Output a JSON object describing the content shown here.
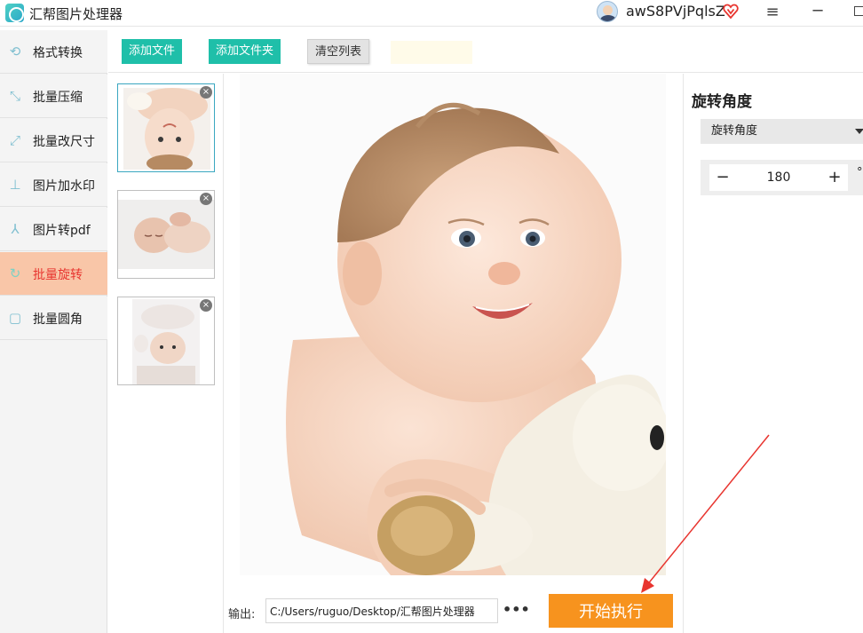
{
  "app": {
    "title": "汇帮图片处理器"
  },
  "user": {
    "name": "awS8PVjPqlsZ"
  },
  "icons": {
    "app_logo": "app-logo-icon",
    "vip": "vip-heart-icon",
    "menu": "≡",
    "minimize": "─"
  },
  "sidebar": {
    "items": [
      {
        "label": "格式转换",
        "icon": "format-convert-icon",
        "glyph": "⟲"
      },
      {
        "label": "批量压缩",
        "icon": "compress-icon",
        "glyph": "⤡"
      },
      {
        "label": "批量改尺寸",
        "icon": "resize-icon",
        "glyph": "⤢"
      },
      {
        "label": "图片加水印",
        "icon": "watermark-icon",
        "glyph": "⊥"
      },
      {
        "label": "图片转pdf",
        "icon": "pdf-icon",
        "glyph": "⅄"
      },
      {
        "label": "批量旋转",
        "icon": "rotate-icon",
        "glyph": "↻",
        "active": true
      },
      {
        "label": "批量圆角",
        "icon": "round-corner-icon",
        "glyph": "▢"
      }
    ]
  },
  "toolbar": {
    "add_file": "添加文件",
    "add_folder": "添加文件夹",
    "clear_list": "清空列表"
  },
  "thumbnails": {
    "close_glyph": "×",
    "count": 3
  },
  "output": {
    "label": "输出:",
    "path": "C:/Users/ruguo/Desktop/汇帮图片处理器",
    "more": "•••",
    "start_button": "开始执行"
  },
  "settings": {
    "title": "旋转角度",
    "select_value": "旋转角度",
    "stepper_minus": "−",
    "stepper_plus": "+",
    "angle_value": "180",
    "unit": "°"
  },
  "colors": {
    "accent_teal": "#1fbfa9",
    "active_nav_bg": "#f9c6a8",
    "active_nav_text": "#e8352f",
    "start_button": "#f7931e",
    "annotation_arrow": "#e8352f"
  }
}
